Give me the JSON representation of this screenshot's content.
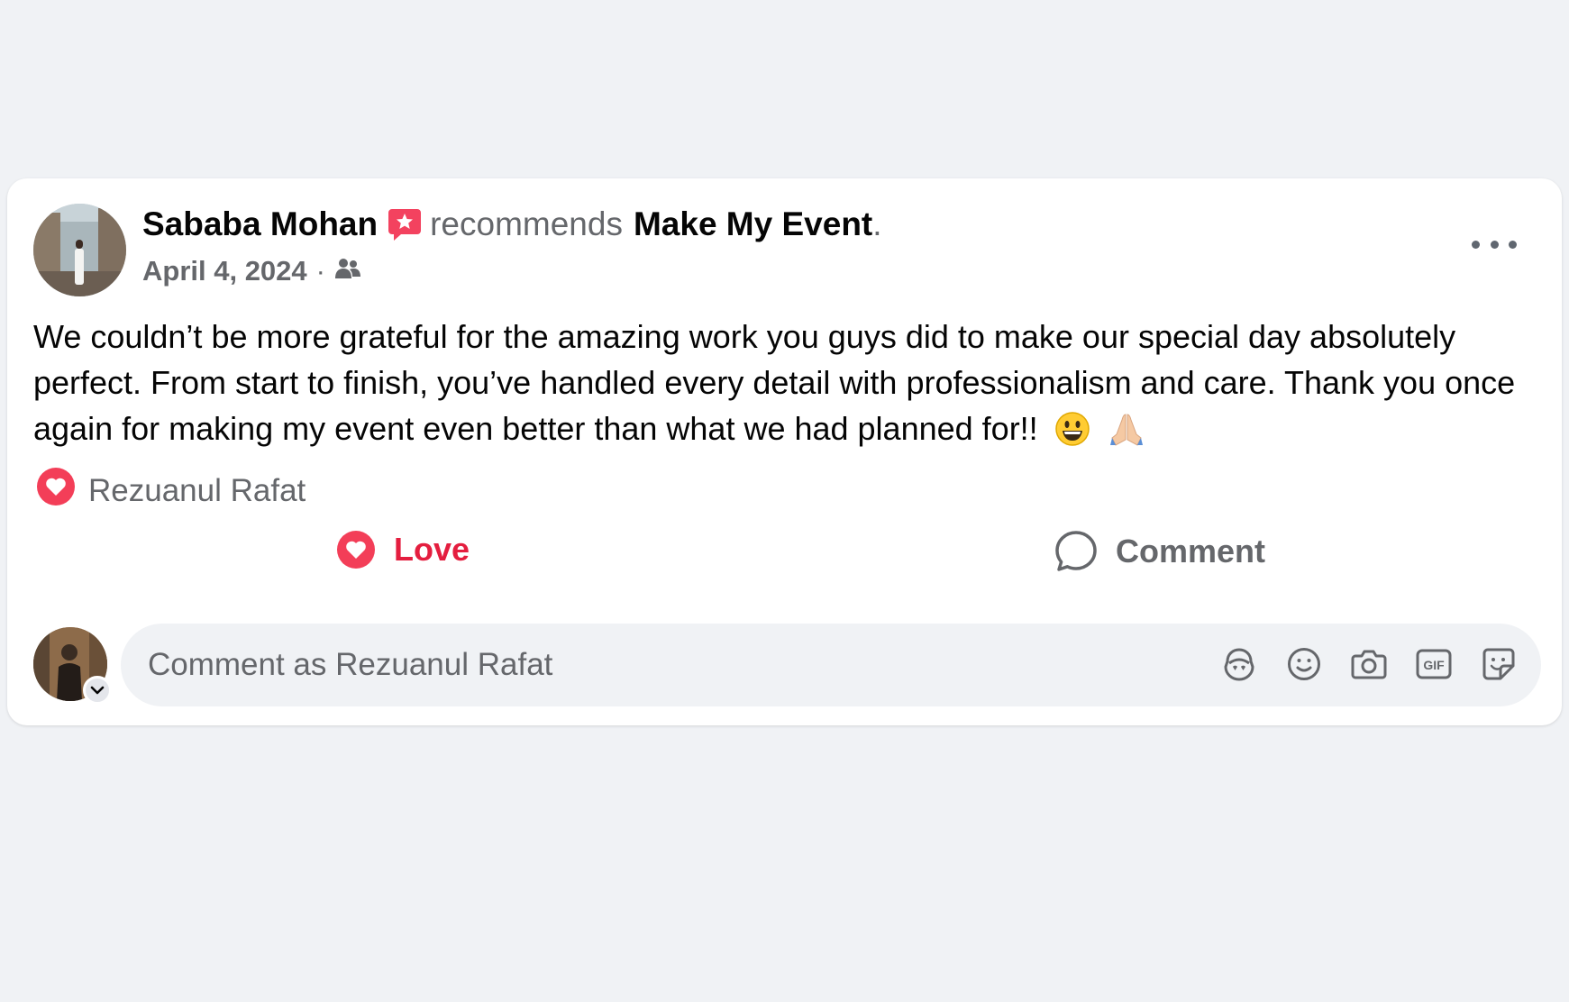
{
  "post": {
    "author": "Sababa Mohan",
    "recommend_word": "recommends",
    "page_name": "Make My Event",
    "period": ".",
    "date": "April 4, 2024",
    "separator": "·",
    "audience_icon": "friends-icon",
    "body": "We couldn’t be more grateful for the amazing work you guys did to make our special day absolutely perfect. From start to finish, you’ve handled every detail with professionalism and care. Thank you once again for making my event even better than what we had planned for!!",
    "emojis": [
      "😀",
      "🙏"
    ]
  },
  "reactions": {
    "reactor_name": "Rezuanul Rafat",
    "reaction_type": "love"
  },
  "actions": {
    "love_label": "Love",
    "comment_label": "Comment"
  },
  "composer": {
    "placeholder": "Comment as Rezuanul Rafat",
    "tool_icons": [
      "avatar-sticker-icon",
      "emoji-icon",
      "camera-icon",
      "gif-icon",
      "sticker-icon"
    ]
  },
  "colors": {
    "love": "#e41e3f",
    "secondary_text": "#65676b",
    "background": "#f0f2f5",
    "recommend_badge": "#f3425f"
  }
}
